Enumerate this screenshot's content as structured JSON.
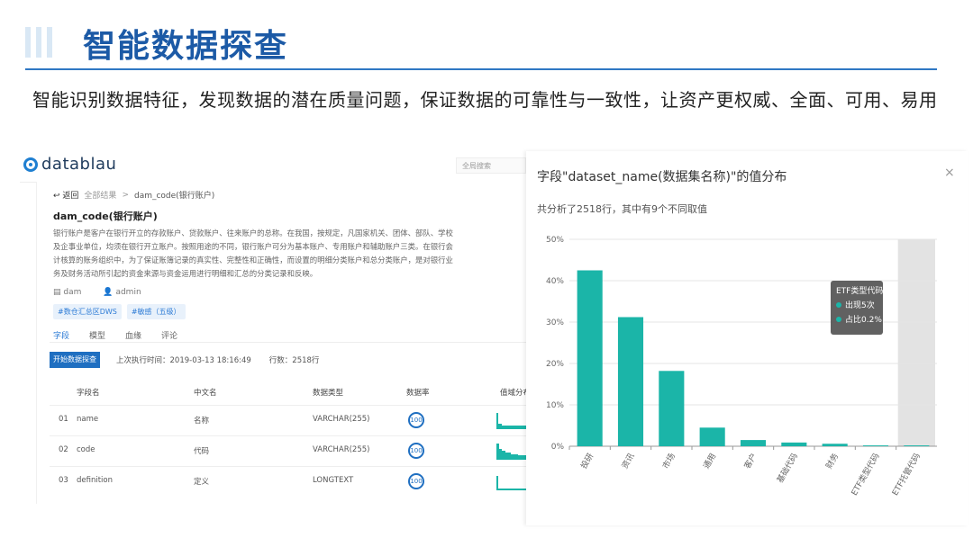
{
  "slide": {
    "title": "智能数据探查",
    "subtitle": "智能识别数据特征，发现数据的潜在质量问题，保证数据的可靠性与一致性，让资产更权威、全面、可用、易用"
  },
  "app": {
    "logo_text": "datablau",
    "search_placeholder": "全局搜索",
    "breadcrumb": {
      "back": "返回",
      "parent": "全部结果",
      "current": "dam_code(银行账户)"
    },
    "asset_title": "dam_code(银行账户)",
    "description": "银行账户是客户在银行开立的存款账户、贷款账户、往来账户的总称。在我国，按规定，凡国家机关、团体、部队、学校及企事业单位，均须在银行开立账户。按照用途的不同，银行账户可分为基本账户、专用账户和辅助账户三类。在银行会计核算的账务组织中，为了保证账簿记录的真实性、完整性和正确性，而设置的明细分类账户和总分类账户，是对银行业务及财务活动所引起的资金来源与资金运用进行明细和汇总的分类记录和反映。",
    "meta": {
      "database": "dam",
      "owner": "admin"
    },
    "tags": [
      "#数仓汇总区DWS",
      "#敏感（五级）"
    ],
    "tabs": [
      "字段",
      "模型",
      "血缘",
      "评论"
    ],
    "run_button": "开始数据探查",
    "last_run": "上次执行时间：2019-03-13 18:16:49",
    "row_count": "行数：2518行",
    "columns": [
      "字段名",
      "中文名",
      "数据类型",
      "数据率",
      "值域分布"
    ],
    "rows": [
      {
        "no": "01",
        "name": "name",
        "cn": "名称",
        "type": "VARCHAR(255)",
        "rate": "100"
      },
      {
        "no": "02",
        "name": "code",
        "cn": "代码",
        "type": "VARCHAR(255)",
        "rate": "100"
      },
      {
        "no": "03",
        "name": "definition",
        "cn": "定义",
        "type": "LONGTEXT",
        "rate": "100"
      }
    ]
  },
  "panel": {
    "title": "字段\"dataset_name(数据集名称)\"的值分布",
    "close": "×",
    "summary": "共分析了2518行，其中有9个不同取值",
    "tooltip": {
      "title": "ETF类型代码",
      "count": "出现5次",
      "ratio": "占比0.2%"
    }
  },
  "chart_data": {
    "type": "bar",
    "categories": [
      "投研",
      "资讯",
      "市场",
      "通用",
      "客户",
      "基础代码",
      "财务",
      "ETF类型代码",
      "ETF托管代码"
    ],
    "values": [
      42.5,
      31.2,
      18.2,
      4.5,
      1.5,
      0.9,
      0.6,
      0.2,
      0.2
    ],
    "ylim": [
      0,
      50
    ],
    "yticks": [
      "0%",
      "10%",
      "20%",
      "30%",
      "40%",
      "50%"
    ],
    "highlight_index": 8,
    "grid": true,
    "bar_color": "#1bb5a8"
  }
}
